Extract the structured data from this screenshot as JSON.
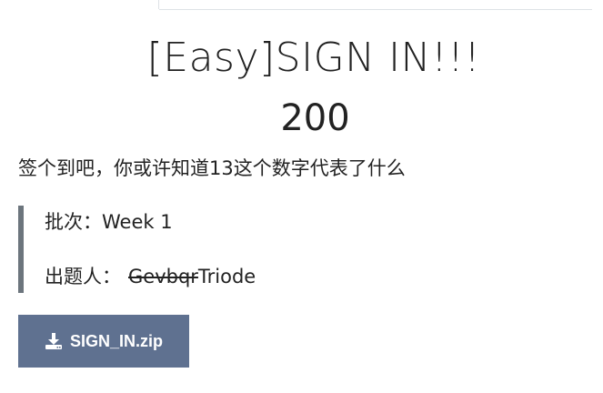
{
  "challenge": {
    "title": "[Easy]SIGN IN!!!",
    "points": "200",
    "description": "签个到吧，你或许知道13这个数字代表了什么",
    "week_label": "批次：",
    "week_value": "Week 1",
    "author_label": "出题人：",
    "author_struck": "Gevbqr",
    "author_name": "Triode"
  },
  "download": {
    "label": "SIGN_IN.zip",
    "icon": "download-icon"
  }
}
